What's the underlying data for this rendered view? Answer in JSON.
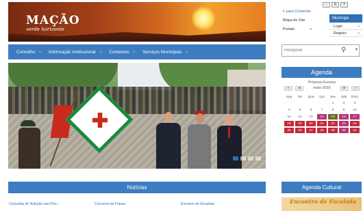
{
  "header": {
    "logo_title": "MAÇÃO",
    "logo_subtitle": "verde horizonte"
  },
  "utility": {
    "font_minus": "-",
    "font_normal": "A",
    "font_plus": "+",
    "links": [
      "Ir para Conteúdo",
      "Mapa do Site",
      "Portais"
    ],
    "portais_arrow": "»",
    "municipe": "Munícipe",
    "login": "Login",
    "registo": "Registo",
    "arrow": "»"
  },
  "nav": {
    "items": [
      "Concelho",
      "Informação Institucional",
      "Contactos",
      "Serviços Municipais"
    ],
    "chevron": "⌵"
  },
  "search": {
    "placeholder": "Pesquisar"
  },
  "agenda": {
    "title": "Agenda",
    "subtitle": "Próximos Eventos",
    "month": "maio 2015",
    "prev_year": "«",
    "prev_month": "◄",
    "next_month": "►",
    "next_year": "»",
    "weekdays": [
      "Seg",
      "Ter",
      "Qua",
      "Qui",
      "Sex",
      "Sáb",
      "Dom"
    ],
    "weeks": [
      [
        "",
        "",
        "",
        "",
        "1",
        "2",
        "3"
      ],
      [
        "4",
        "5",
        "6",
        "7",
        "8",
        "9",
        "10"
      ],
      [
        "11",
        "12",
        "13",
        "14",
        "15",
        "16",
        "17"
      ],
      [
        "18",
        "19",
        "20",
        "21",
        "22",
        "23",
        "24"
      ],
      [
        "25",
        "26",
        "27",
        "28",
        "29",
        "30",
        "31"
      ]
    ]
  },
  "sections": {
    "noticias": "Notícias",
    "agenda_cultural": "Agenda Cultural"
  },
  "news": [
    "Consultas de Nutrição nas Ptss...",
    "Concurso de Frases",
    "Encontro de Escalada"
  ],
  "agenda_cultural_banner": {
    "title": "Encontro de Escalada"
  }
}
